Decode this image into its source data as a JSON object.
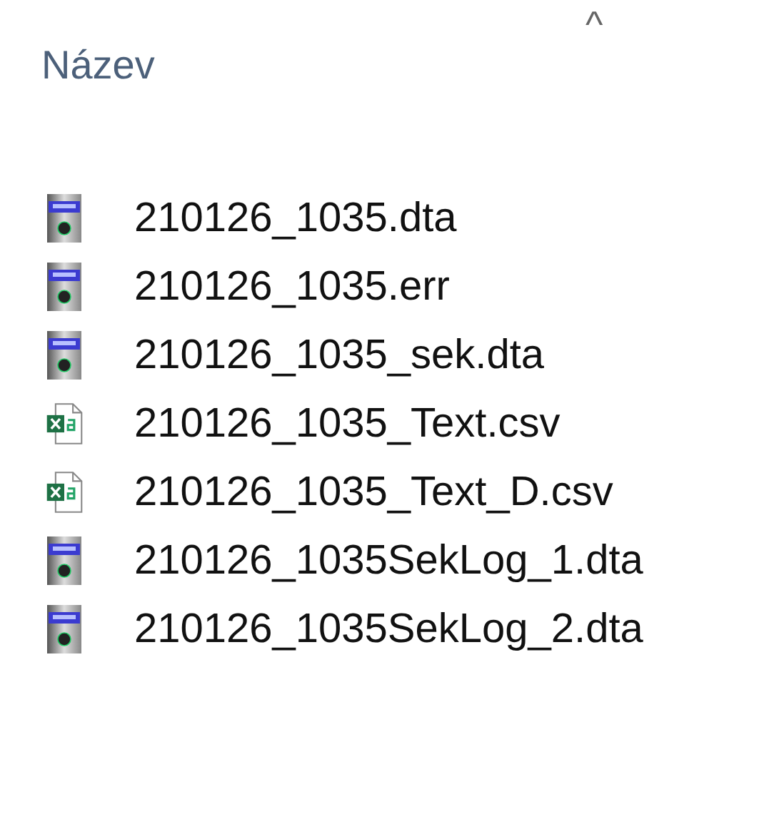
{
  "column_header": {
    "label": "Název",
    "sort_indicator": "^"
  },
  "files": [
    {
      "name": "210126_1035.dta",
      "kind": "data"
    },
    {
      "name": "210126_1035.err",
      "kind": "data"
    },
    {
      "name": "210126_1035_sek.dta",
      "kind": "data"
    },
    {
      "name": "210126_1035_Text.csv",
      "kind": "csv"
    },
    {
      "name": "210126_1035_Text_D.csv",
      "kind": "csv"
    },
    {
      "name": "210126_1035SekLog_1.dta",
      "kind": "data"
    },
    {
      "name": "210126_1035SekLog_2.dta",
      "kind": "data"
    }
  ]
}
